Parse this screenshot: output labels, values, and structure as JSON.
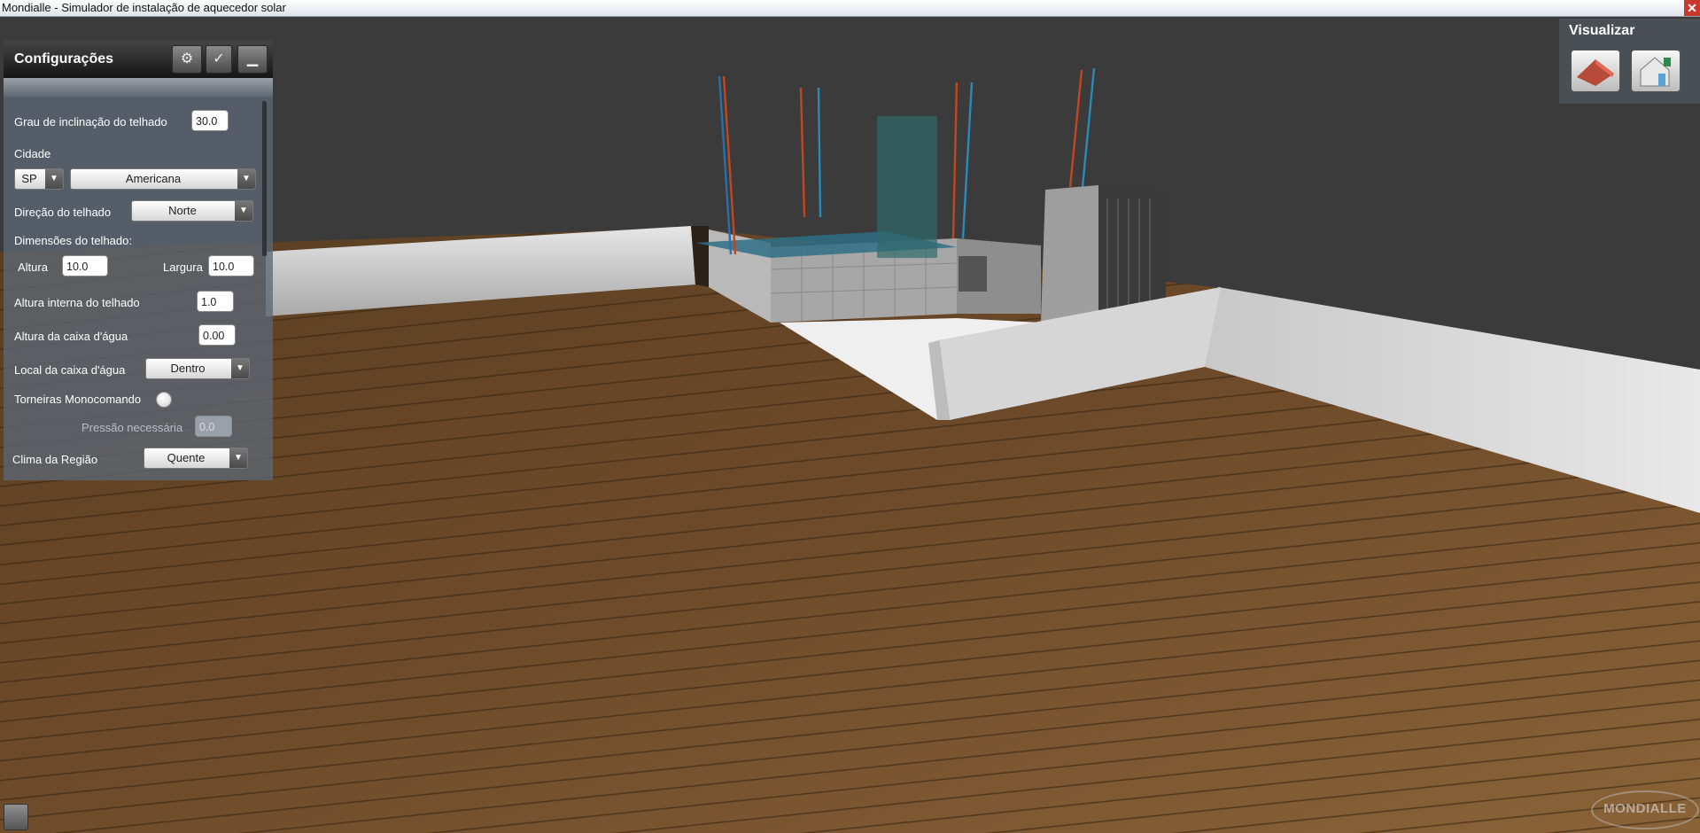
{
  "window": {
    "title": "Mondialle - Simulador de instalação de aquecedor solar",
    "close_glyph": "✕"
  },
  "config_panel": {
    "title": "Configurações",
    "buttons": [
      {
        "icon": "gears-icon",
        "glyph": "⚙"
      },
      {
        "icon": "check-icon",
        "glyph": "✓"
      },
      {
        "icon": "minimize-icon",
        "glyph": "▁"
      }
    ],
    "fields": {
      "roof_angle": {
        "label": "Grau de inclinação do telhado",
        "value": "30.0"
      },
      "city_label": "Cidade",
      "state": {
        "value": "SP"
      },
      "city": {
        "value": "Americana"
      },
      "roof_direction": {
        "label": "Direção do telhado",
        "value": "Norte"
      },
      "roof_dimensions_label": "Dimensões do telhado:",
      "height": {
        "label": "Altura",
        "value": "10.0"
      },
      "width": {
        "label": "Largura",
        "value": "10.0"
      },
      "inner_height": {
        "label": "Altura interna do telhado",
        "value": "1.0"
      },
      "tank_height": {
        "label": "Altura da caixa d'água",
        "value": "0.00"
      },
      "tank_location": {
        "label": "Local da caixa d'água",
        "value": "Dentro"
      },
      "mono_faucets": {
        "label": "Torneiras Monocomando",
        "checked": false
      },
      "pressure": {
        "label": "Pressão necessária",
        "value": "0.0",
        "disabled": true
      },
      "climate": {
        "label": "Clima da Região",
        "value": "Quente"
      }
    }
  },
  "visualizar": {
    "title": "Visualizar",
    "buttons": [
      {
        "icon": "roof-view-icon"
      },
      {
        "icon": "house-info-view-icon"
      }
    ]
  },
  "footer": {
    "doc_icon": "document-icon",
    "logo_text": "MONDIALLE"
  },
  "colors": {
    "sky": "#3b3b3b",
    "floor": "#6b4a2c",
    "wall": "#d8d8d8",
    "panel": "#5c6674",
    "accent_close": "#c8392b"
  }
}
